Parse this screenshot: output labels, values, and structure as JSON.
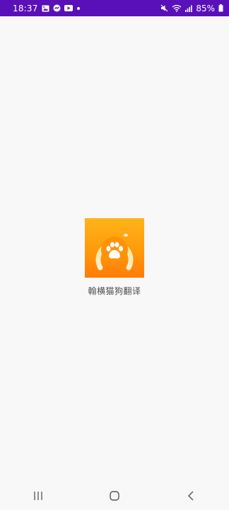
{
  "status_bar": {
    "time": "18:37",
    "battery": "85%",
    "background_color": "#5a10b8",
    "left_icons": [
      "gallery-icon",
      "messenger-icon",
      "youtube-icon",
      "dot-icon"
    ],
    "right_icons": [
      "mute-icon",
      "wifi-icon",
      "signal-icon",
      "battery-icon"
    ]
  },
  "splash": {
    "app_name": "翰横猫狗翻译",
    "icon": "paw-icon",
    "icon_colors": [
      "#ffb41a",
      "#ff7b08"
    ]
  },
  "nav_bar": {
    "buttons": [
      "recent-apps-icon",
      "home-icon",
      "back-icon"
    ]
  }
}
